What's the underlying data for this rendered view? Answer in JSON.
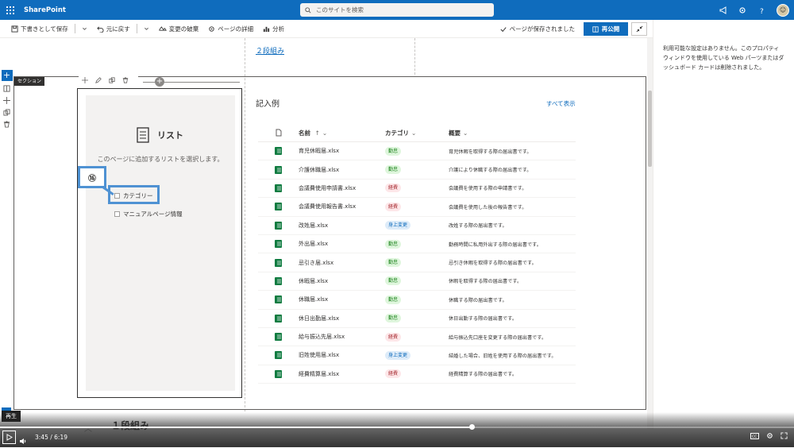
{
  "app": {
    "brand": "SharePoint",
    "search_placeholder": "このサイトを検索"
  },
  "commands": {
    "save_draft": "下書きとして保存",
    "undo": "元に戻す",
    "discard": "変更の破棄",
    "page_details": "ページの詳細",
    "analytics": "分析",
    "saved_status": "ページが保存されました",
    "republish": "再公開"
  },
  "right_pane": {
    "message": "利用可能な設定はありません。このプロパティ ウィンドウを使用している Web パーツまたはダッシュボード カードは削除されました。"
  },
  "canvas": {
    "prev_section_link": "２段組み",
    "section_tag": "セクション",
    "next_section_heading": "１段組み"
  },
  "list_webpart": {
    "title": "リスト",
    "description": "このページに追加するリストを選択します。",
    "options": [
      "カテゴリー",
      "マニュアルページ情報"
    ],
    "step_badge": "⑯"
  },
  "library": {
    "title": "記入例",
    "see_all": "すべて表示",
    "columns": {
      "name": "名前",
      "category": "カテゴリ",
      "desc": "概要",
      "sort": "↑"
    },
    "rows": [
      {
        "name": "育児休暇届.xlsx",
        "cat": "勤怠",
        "desc": "育児休暇を取得する際の届出書です。"
      },
      {
        "name": "介護休職届.xlsx",
        "cat": "勤怠",
        "desc": "介護により休職する際の届出書です。"
      },
      {
        "name": "会議費使用申請書.xlsx",
        "cat": "経費",
        "desc": "会議費を使用する際の申請書です。"
      },
      {
        "name": "会議費使用報告書.xlsx",
        "cat": "経費",
        "desc": "会議費を使用した後の報告書です。"
      },
      {
        "name": "改姓届.xlsx",
        "cat": "身上変更",
        "desc": "改姓する際の届出書です。"
      },
      {
        "name": "外出届.xlsx",
        "cat": "勤怠",
        "desc": "勤務時間に私用外出する際の届出書です。"
      },
      {
        "name": "忌引き届.xlsx",
        "cat": "勤怠",
        "desc": "忌引き休暇を取得する際の届出書です。"
      },
      {
        "name": "休暇届.xlsx",
        "cat": "勤怠",
        "desc": "休暇を取得する際の届出書です。"
      },
      {
        "name": "休職届.xlsx",
        "cat": "勤怠",
        "desc": "休職する際の届出書です。"
      },
      {
        "name": "休日出勤届.xlsx",
        "cat": "勤怠",
        "desc": "休日出勤する際の届出書です。"
      },
      {
        "name": "給与振込先届.xlsx",
        "cat": "経費",
        "desc": "給与振込先口座を変更する際の届出書です。"
      },
      {
        "name": "旧姓使用届.xlsx",
        "cat": "身上変更",
        "desc": "結婚した場合、旧姓を使用する際の届出書です。"
      },
      {
        "name": "経費精算届.xlsx",
        "cat": "経費",
        "desc": "経費精算する際の届出書です。"
      }
    ]
  },
  "category_colors": {
    "勤怠": {
      "bg": "#dff6dd",
      "fg": "#107c10"
    },
    "経費": {
      "bg": "#fde7e9",
      "fg": "#a4262c"
    },
    "身上変更": {
      "bg": "#deecf9",
      "fg": "#0f6cbd"
    }
  },
  "player": {
    "tooltip": "再生",
    "current_time": "3:45",
    "separator": "/",
    "total_time": "6:19",
    "progress": 0.594
  },
  "colors": {
    "brand": "#0f6cbd",
    "highlight": "#4f92d3"
  }
}
